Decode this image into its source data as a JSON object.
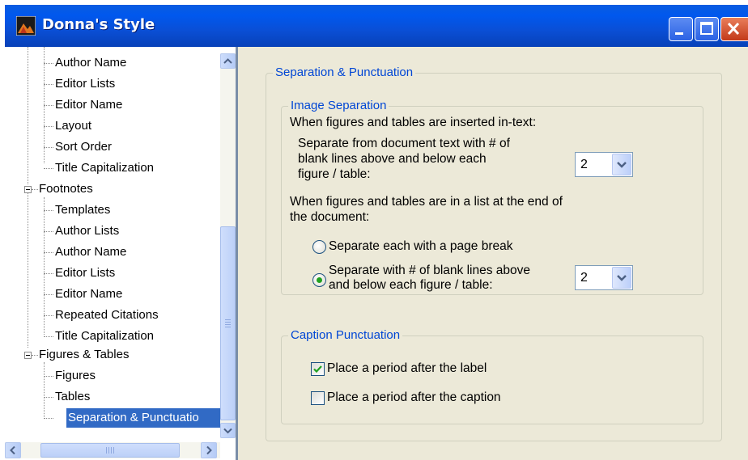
{
  "window": {
    "title": "Donna's Style"
  },
  "tree": {
    "nodes": [
      {
        "label": "Author Name",
        "level": 2
      },
      {
        "label": "Editor Lists",
        "level": 2
      },
      {
        "label": "Editor Name",
        "level": 2
      },
      {
        "label": "Layout",
        "level": 2
      },
      {
        "label": "Sort Order",
        "level": 2
      },
      {
        "label": "Title Capitalization",
        "level": 2
      },
      {
        "label": "Footnotes",
        "level": 1,
        "expanded": true
      },
      {
        "label": "Templates",
        "level": 2
      },
      {
        "label": "Author Lists",
        "level": 2
      },
      {
        "label": "Author Name",
        "level": 2
      },
      {
        "label": "Editor Lists",
        "level": 2
      },
      {
        "label": "Editor Name",
        "level": 2
      },
      {
        "label": "Repeated Citations",
        "level": 2
      },
      {
        "label": "Title Capitalization",
        "level": 2
      },
      {
        "label": "Figures & Tables",
        "level": 1,
        "expanded": true
      },
      {
        "label": "Figures",
        "level": 2
      },
      {
        "label": "Tables",
        "level": 2
      },
      {
        "label": "Separation & Punctuatio",
        "level": 2,
        "selected": true
      }
    ]
  },
  "panel": {
    "title": "Separation & Punctuation",
    "image_separation": {
      "legend": "Image Separation",
      "intext_heading": "When figures and tables are inserted in-text:",
      "intext_desc": [
        "Separate from document text with # of",
        "blank lines above and below each",
        "figure / table:"
      ],
      "intext_lines": "2",
      "endlist_heading": [
        "When figures and tables are in a list at the end of",
        "the document:"
      ],
      "radio_page_break": {
        "label": "Separate each with a page break",
        "checked": false
      },
      "radio_blank_lines": {
        "label": [
          "Separate with # of blank lines above",
          "and below each figure / table:"
        ],
        "checked": true
      },
      "endlist_lines": "2"
    },
    "caption_punctuation": {
      "legend": "Caption Punctuation",
      "after_label": {
        "label": "Place a period after the label",
        "checked": true
      },
      "after_caption": {
        "label": "Place a period after the caption",
        "checked": false
      }
    }
  },
  "colors": {
    "titlebar": "#0058ee",
    "selection": "#316ac5",
    "legend_text": "#0046d5",
    "dialog_bg": "#ece9d8",
    "radio_dot": "#21a121"
  }
}
